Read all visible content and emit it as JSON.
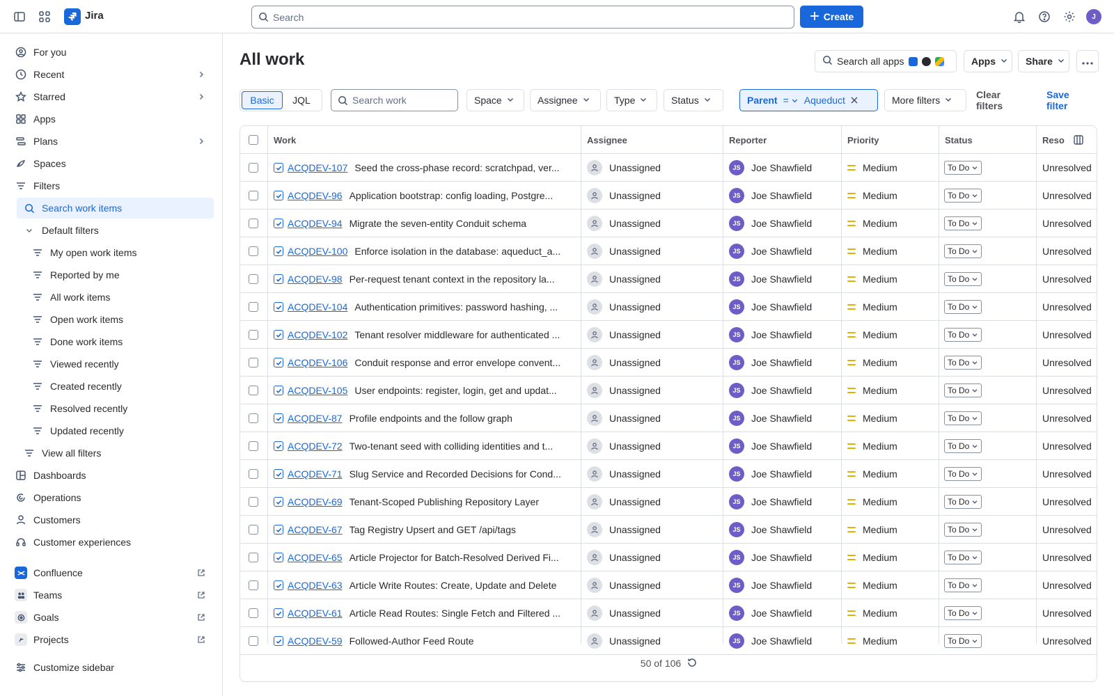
{
  "app": {
    "name": "Jira"
  },
  "topbar": {
    "search_placeholder": "Search",
    "create_label": "Create",
    "user_initials": "J"
  },
  "sidebar": {
    "items": [
      {
        "label": "For you",
        "icon": "user-circle-icon"
      },
      {
        "label": "Recent",
        "icon": "clock-icon"
      },
      {
        "label": "Starred",
        "icon": "star-icon"
      },
      {
        "label": "Apps",
        "icon": "apps-icon"
      },
      {
        "label": "Plans",
        "icon": "plans-icon"
      },
      {
        "label": "Spaces",
        "icon": "spaces-icon"
      },
      {
        "label": "Filters",
        "icon": "filter-icon"
      }
    ],
    "search_work_items": "Search work items",
    "default_filters": "Default filters",
    "filters": [
      "My open work items",
      "Reported by me",
      "All work items",
      "Open work items",
      "Done work items",
      "Viewed recently",
      "Created recently",
      "Resolved recently",
      "Updated recently"
    ],
    "view_all_filters": "View all filters",
    "bottom_items": [
      {
        "label": "Dashboards"
      },
      {
        "label": "Operations"
      },
      {
        "label": "Customers"
      },
      {
        "label": "Customer experiences"
      }
    ],
    "apps": [
      {
        "label": "Confluence",
        "color": "#1868db"
      },
      {
        "label": "Teams",
        "color": "#44546f"
      },
      {
        "label": "Goals",
        "color": "#44546f"
      },
      {
        "label": "Projects",
        "color": "#44546f"
      }
    ],
    "customize": "Customize sidebar"
  },
  "main": {
    "title": "All work",
    "search_all_apps": "Search all apps",
    "apps_btn": "Apps",
    "share_btn": "Share",
    "toggle_basic": "Basic",
    "toggle_jql": "JQL",
    "search_work_placeholder": "Search work",
    "filters": {
      "space": "Space",
      "assignee": "Assignee",
      "type": "Type",
      "status": "Status",
      "more": "More filters"
    },
    "parent_filter": {
      "field": "Parent",
      "op": "=",
      "value": "Aqueduct"
    },
    "clear_filters": "Clear filters",
    "save_filter": "Save filter"
  },
  "table": {
    "columns": {
      "work": "Work",
      "assignee": "Assignee",
      "reporter": "Reporter",
      "priority": "Priority",
      "status": "Status",
      "resolution": "Reso"
    },
    "rows": [
      {
        "key": "ACQDEV-107",
        "summary": "Seed the cross-phase record: scratchpad, ver...",
        "assignee": "Unassigned",
        "reporter": "Joe Shawfield",
        "reporter_initials": "JS",
        "priority": "Medium",
        "status": "To Do",
        "resolution": "Unresolved"
      },
      {
        "key": "ACQDEV-96",
        "summary": "Application bootstrap: config loading, Postgre...",
        "assignee": "Unassigned",
        "reporter": "Joe Shawfield",
        "reporter_initials": "JS",
        "priority": "Medium",
        "status": "To Do",
        "resolution": "Unresolved"
      },
      {
        "key": "ACQDEV-94",
        "summary": "Migrate the seven-entity Conduit schema",
        "assignee": "Unassigned",
        "reporter": "Joe Shawfield",
        "reporter_initials": "JS",
        "priority": "Medium",
        "status": "To Do",
        "resolution": "Unresolved"
      },
      {
        "key": "ACQDEV-100",
        "summary": "Enforce isolation in the database: aqueduct_a...",
        "assignee": "Unassigned",
        "reporter": "Joe Shawfield",
        "reporter_initials": "JS",
        "priority": "Medium",
        "status": "To Do",
        "resolution": "Unresolved"
      },
      {
        "key": "ACQDEV-98",
        "summary": "Per-request tenant context in the repository la...",
        "assignee": "Unassigned",
        "reporter": "Joe Shawfield",
        "reporter_initials": "JS",
        "priority": "Medium",
        "status": "To Do",
        "resolution": "Unresolved"
      },
      {
        "key": "ACQDEV-104",
        "summary": "Authentication primitives: password hashing, ...",
        "assignee": "Unassigned",
        "reporter": "Joe Shawfield",
        "reporter_initials": "JS",
        "priority": "Medium",
        "status": "To Do",
        "resolution": "Unresolved"
      },
      {
        "key": "ACQDEV-102",
        "summary": "Tenant resolver middleware for authenticated ...",
        "assignee": "Unassigned",
        "reporter": "Joe Shawfield",
        "reporter_initials": "JS",
        "priority": "Medium",
        "status": "To Do",
        "resolution": "Unresolved"
      },
      {
        "key": "ACQDEV-106",
        "summary": "Conduit response and error envelope convent...",
        "assignee": "Unassigned",
        "reporter": "Joe Shawfield",
        "reporter_initials": "JS",
        "priority": "Medium",
        "status": "To Do",
        "resolution": "Unresolved"
      },
      {
        "key": "ACQDEV-105",
        "summary": "User endpoints: register, login, get and updat...",
        "assignee": "Unassigned",
        "reporter": "Joe Shawfield",
        "reporter_initials": "JS",
        "priority": "Medium",
        "status": "To Do",
        "resolution": "Unresolved"
      },
      {
        "key": "ACQDEV-87",
        "summary": "Profile endpoints and the follow graph",
        "assignee": "Unassigned",
        "reporter": "Joe Shawfield",
        "reporter_initials": "JS",
        "priority": "Medium",
        "status": "To Do",
        "resolution": "Unresolved"
      },
      {
        "key": "ACQDEV-72",
        "summary": "Two-tenant seed with colliding identities and t...",
        "assignee": "Unassigned",
        "reporter": "Joe Shawfield",
        "reporter_initials": "JS",
        "priority": "Medium",
        "status": "To Do",
        "resolution": "Unresolved"
      },
      {
        "key": "ACQDEV-71",
        "summary": "Slug Service and Recorded Decisions for Cond...",
        "assignee": "Unassigned",
        "reporter": "Joe Shawfield",
        "reporter_initials": "JS",
        "priority": "Medium",
        "status": "To Do",
        "resolution": "Unresolved"
      },
      {
        "key": "ACQDEV-69",
        "summary": "Tenant-Scoped Publishing Repository Layer",
        "assignee": "Unassigned",
        "reporter": "Joe Shawfield",
        "reporter_initials": "JS",
        "priority": "Medium",
        "status": "To Do",
        "resolution": "Unresolved"
      },
      {
        "key": "ACQDEV-67",
        "summary": "Tag Registry Upsert and GET /api/tags",
        "assignee": "Unassigned",
        "reporter": "Joe Shawfield",
        "reporter_initials": "JS",
        "priority": "Medium",
        "status": "To Do",
        "resolution": "Unresolved"
      },
      {
        "key": "ACQDEV-65",
        "summary": "Article Projector for Batch-Resolved Derived Fi...",
        "assignee": "Unassigned",
        "reporter": "Joe Shawfield",
        "reporter_initials": "JS",
        "priority": "Medium",
        "status": "To Do",
        "resolution": "Unresolved"
      },
      {
        "key": "ACQDEV-63",
        "summary": "Article Write Routes: Create, Update and Delete",
        "assignee": "Unassigned",
        "reporter": "Joe Shawfield",
        "reporter_initials": "JS",
        "priority": "Medium",
        "status": "To Do",
        "resolution": "Unresolved"
      },
      {
        "key": "ACQDEV-61",
        "summary": "Article Read Routes: Single Fetch and Filtered ...",
        "assignee": "Unassigned",
        "reporter": "Joe Shawfield",
        "reporter_initials": "JS",
        "priority": "Medium",
        "status": "To Do",
        "resolution": "Unresolved"
      },
      {
        "key": "ACQDEV-59",
        "summary": "Followed-Author Feed Route",
        "assignee": "Unassigned",
        "reporter": "Joe Shawfield",
        "reporter_initials": "JS",
        "priority": "Medium",
        "status": "To Do",
        "resolution": "Unresolved"
      }
    ],
    "pagination": "50 of 106"
  },
  "colors": {
    "accent": "#1868db",
    "avatar": "#6e5dc6",
    "priority_medium": "#e2b203"
  }
}
